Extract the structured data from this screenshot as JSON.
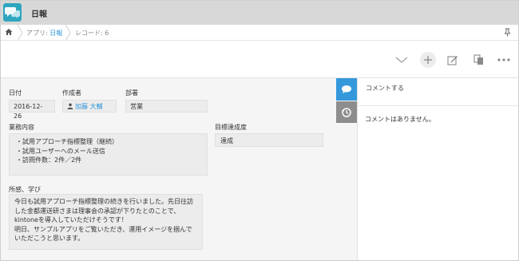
{
  "header": {
    "app_title": "日報",
    "app_icon": "comment-bubbles-icon"
  },
  "breadcrumb": {
    "app_prefix": "アプリ: ",
    "app_name": "日報",
    "record_label": "レコード: 6"
  },
  "toolbar": {
    "icons": [
      "chevron-down-icon",
      "add-icon",
      "edit-icon",
      "copy-icon",
      "more-icon"
    ]
  },
  "fields": {
    "date": {
      "label": "日付",
      "value": "2016-12-26"
    },
    "creator": {
      "label": "作成者",
      "value": "加藤 大輔"
    },
    "department": {
      "label": "部署",
      "value": "営業"
    },
    "work": {
      "label": "業務内容",
      "lines": [
        "・試用アプローチ指標整理（継続）",
        "・試用ユーザーへのメール送信",
        "・訪問件数：2件／2件"
      ]
    },
    "goal": {
      "label": "目標達成度",
      "value": "達成"
    },
    "notes": {
      "label": "所感、学び",
      "lines": [
        "今日も試用アプローチ指標整理の続きを行いました。先日往訪",
        "した金都運送研さまは理事会の承認が下りたとのことで、",
        "kintoneを導入していただけそうです！",
        "明日、サンプルアプリをご覧いただき、運用イメージを掴んで",
        "いただこうと思います。"
      ]
    }
  },
  "comments": {
    "input_placeholder": "コメントする",
    "empty_text": "コメントはありません。"
  },
  "colors": {
    "accent": "#3498db",
    "header_bg": "#d8d8d8",
    "app_icon_bg": "#2fa6bf"
  }
}
